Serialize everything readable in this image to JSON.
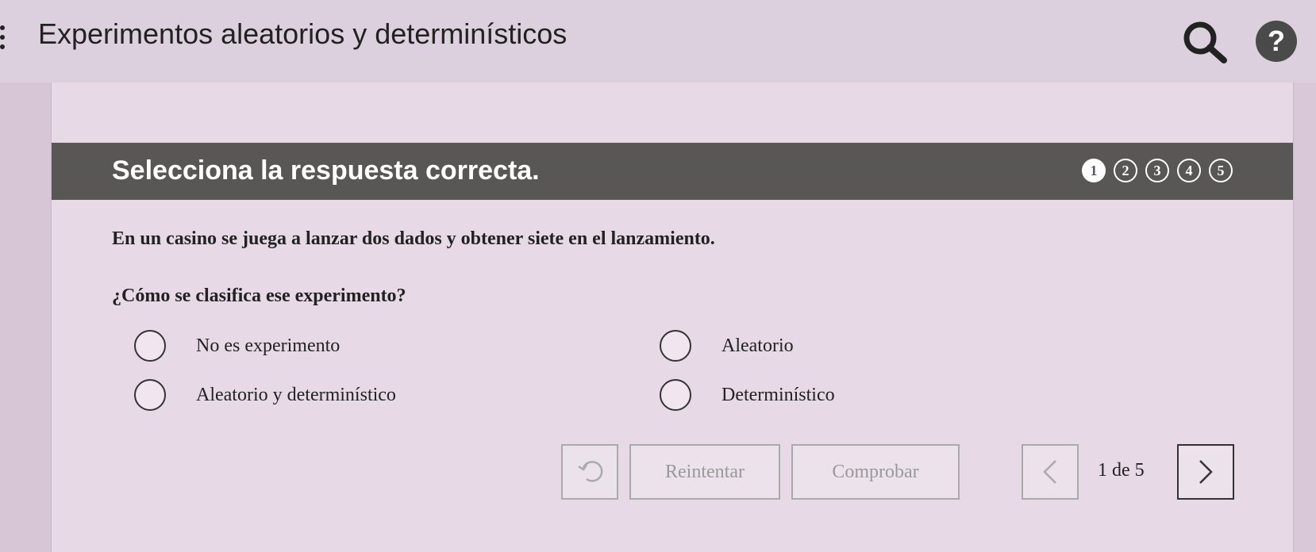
{
  "header": {
    "title": "Experimentos aleatorios y determinísticos",
    "search_icon": "search-icon",
    "help_icon": "help-icon",
    "help_glyph": "?"
  },
  "instruction": {
    "text": "Selecciona la respuesta correcta.",
    "steps": [
      {
        "label": "1",
        "state": "active"
      },
      {
        "label": "2",
        "state": "inactive"
      },
      {
        "label": "3",
        "state": "inactive"
      },
      {
        "label": "4",
        "state": "inactive"
      },
      {
        "label": "5",
        "state": "inactive"
      }
    ]
  },
  "question": {
    "statement": "En un casino se juega a lanzar dos dados y obtener siete en el lanzamiento.",
    "prompt": "¿Cómo se clasifica ese experimento?",
    "options": [
      {
        "label": "No es experimento",
        "selected": false
      },
      {
        "label": "Aleatorio",
        "selected": false
      },
      {
        "label": "Aleatorio y determinístico",
        "selected": false
      },
      {
        "label": "Determinístico",
        "selected": false
      }
    ]
  },
  "controls": {
    "undo_icon": "undo-icon",
    "retry_label": "Reintentar",
    "check_label": "Comprobar",
    "prev_icon": "chevron-left-icon",
    "next_icon": "chevron-right-icon",
    "page_indicator": "1 de 5"
  },
  "colors": {
    "instruction_bar": "#595656",
    "background": "#e7d9e6",
    "disabled_text": "#999999"
  }
}
